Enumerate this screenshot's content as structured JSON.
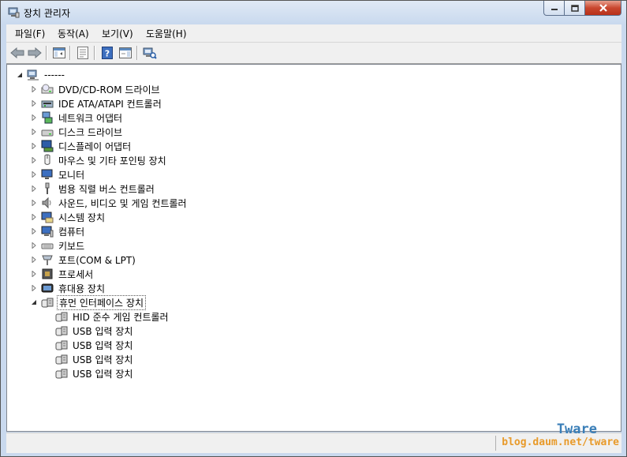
{
  "window": {
    "title": "장치 관리자"
  },
  "menu": [
    "파일(F)",
    "동작(A)",
    "보기(V)",
    "도움말(H)"
  ],
  "toolbar": {
    "icons": [
      "back-arrow-icon",
      "forward-arrow-icon",
      "show-hide-console-tree-icon",
      "properties-icon",
      "help-icon",
      "show-action-pane-icon",
      "scan-hardware-icon"
    ]
  },
  "tree": {
    "root": {
      "label": "------",
      "expanded": true
    },
    "categories": [
      {
        "label": "DVD/CD-ROM 드라이브",
        "icon": "dvd-drive-icon",
        "expanded": false
      },
      {
        "label": "IDE ATA/ATAPI 컨트롤러",
        "icon": "ide-controller-icon",
        "expanded": false
      },
      {
        "label": "네트워크 어댑터",
        "icon": "network-adapter-icon",
        "expanded": false
      },
      {
        "label": "디스크 드라이브",
        "icon": "disk-drive-icon",
        "expanded": false
      },
      {
        "label": "디스플레이 어댑터",
        "icon": "display-adapter-icon",
        "expanded": false
      },
      {
        "label": "마우스 및 기타 포인팅 장치",
        "icon": "mouse-icon",
        "expanded": false
      },
      {
        "label": "모니터",
        "icon": "monitor-icon",
        "expanded": false
      },
      {
        "label": "범용 직렬 버스 컨트롤러",
        "icon": "usb-controller-icon",
        "expanded": false
      },
      {
        "label": "사운드, 비디오 및 게임 컨트롤러",
        "icon": "sound-icon",
        "expanded": false
      },
      {
        "label": "시스템 장치",
        "icon": "system-device-icon",
        "expanded": false
      },
      {
        "label": "컴퓨터",
        "icon": "computer-icon",
        "expanded": false
      },
      {
        "label": "키보드",
        "icon": "keyboard-icon",
        "expanded": false
      },
      {
        "label": "포트(COM & LPT)",
        "icon": "port-icon",
        "expanded": false
      },
      {
        "label": "프로세서",
        "icon": "processor-icon",
        "expanded": false
      },
      {
        "label": "휴대용 장치",
        "icon": "portable-device-icon",
        "expanded": false
      },
      {
        "label": "휴먼 인터페이스 장치",
        "icon": "hid-icon",
        "expanded": true,
        "selected": true
      }
    ],
    "hid_children": [
      "HID 준수 게임 컨트롤러",
      "USB 입력 장치",
      "USB 입력 장치",
      "USB 입력 장치",
      "USB 입력 장치"
    ]
  },
  "watermark": {
    "title": "Tware",
    "url": "blog.daum.net/tware"
  },
  "colors": {
    "watermark_title": "#3b7fb8",
    "watermark_url": "#e89a2a",
    "selection_border": "#555555"
  }
}
